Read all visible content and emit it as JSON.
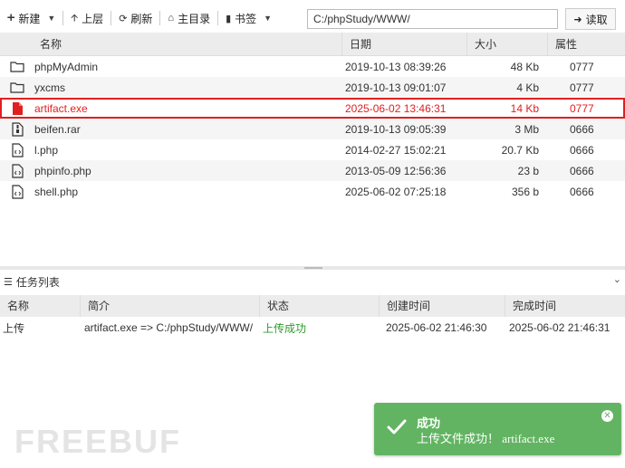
{
  "toolbar": {
    "new_label": "新建",
    "up_label": "上层",
    "refresh_label": "刷新",
    "home_label": "主目录",
    "bookmark_label": "书签",
    "path_value": "C:/phpStudy/WWW/",
    "read_label": "读取"
  },
  "file_table": {
    "columns": [
      "名称",
      "日期",
      "大小",
      "属性"
    ],
    "rows": [
      {
        "type": "folder",
        "name": "phpMyAdmin",
        "date": "2019-10-13 08:39:26",
        "size": "48 Kb",
        "attr": "0777"
      },
      {
        "type": "folder",
        "name": "yxcms",
        "date": "2019-10-13 09:01:07",
        "size": "4 Kb",
        "attr": "0777"
      },
      {
        "type": "file-red",
        "name": "artifact.exe",
        "date": "2025-06-02 13:46:31",
        "size": "14 Kb",
        "attr": "0777"
      },
      {
        "type": "archive",
        "name": "beifen.rar",
        "date": "2019-10-13 09:05:39",
        "size": "3 Mb",
        "attr": "0666"
      },
      {
        "type": "code",
        "name": "l.php",
        "date": "2014-02-27 15:02:21",
        "size": "20.7 Kb",
        "attr": "0666"
      },
      {
        "type": "code",
        "name": "phpinfo.php",
        "date": "2013-05-09 12:56:36",
        "size": "23 b",
        "attr": "0666"
      },
      {
        "type": "code",
        "name": "shell.php",
        "date": "2025-06-02 07:25:18",
        "size": "356 b",
        "attr": "0666"
      }
    ]
  },
  "task_panel": {
    "title": "任务列表",
    "columns": [
      "名称",
      "简介",
      "状态",
      "创建时间",
      "完成时间"
    ],
    "rows": [
      {
        "name": "上传",
        "desc": "artifact.exe => C:/phpStudy/WWW/",
        "status": "上传成功",
        "created": "2025-06-02 21:46:30",
        "finished": "2025-06-02 21:46:31"
      }
    ]
  },
  "toast": {
    "title": "成功",
    "message": "上传文件成功！ artifact.exe",
    "color": "#62b462"
  },
  "watermark": {
    "text": "FREEBUF"
  },
  "colors": {
    "highlight": "#e02020",
    "success_text": "#2e9b2e"
  }
}
